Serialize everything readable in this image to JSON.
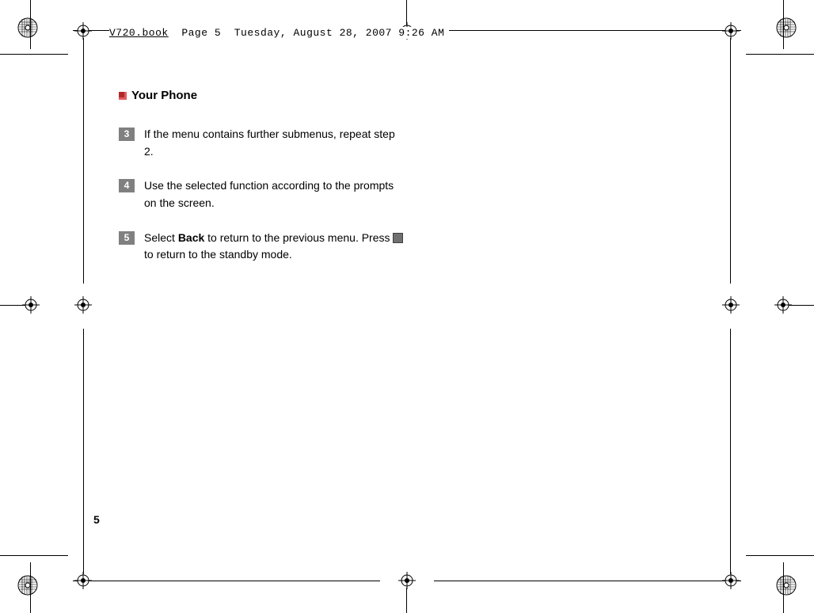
{
  "header": {
    "filename": "V720.book",
    "pageinfo": "Page 5",
    "datetime": "Tuesday, August 28, 2007  9:26 AM"
  },
  "section": {
    "title": "Your Phone"
  },
  "steps": [
    {
      "num": "3",
      "text": "If the menu contains further submenus, repeat step 2."
    },
    {
      "num": "4",
      "text": "Use the selected function according to the prompts on the screen."
    },
    {
      "num": "5",
      "pre": "Select ",
      "bold": "Back",
      "mid": " to return to the previous menu. Press ",
      "post": " to return to the standby mode."
    }
  ],
  "page_number": "5"
}
